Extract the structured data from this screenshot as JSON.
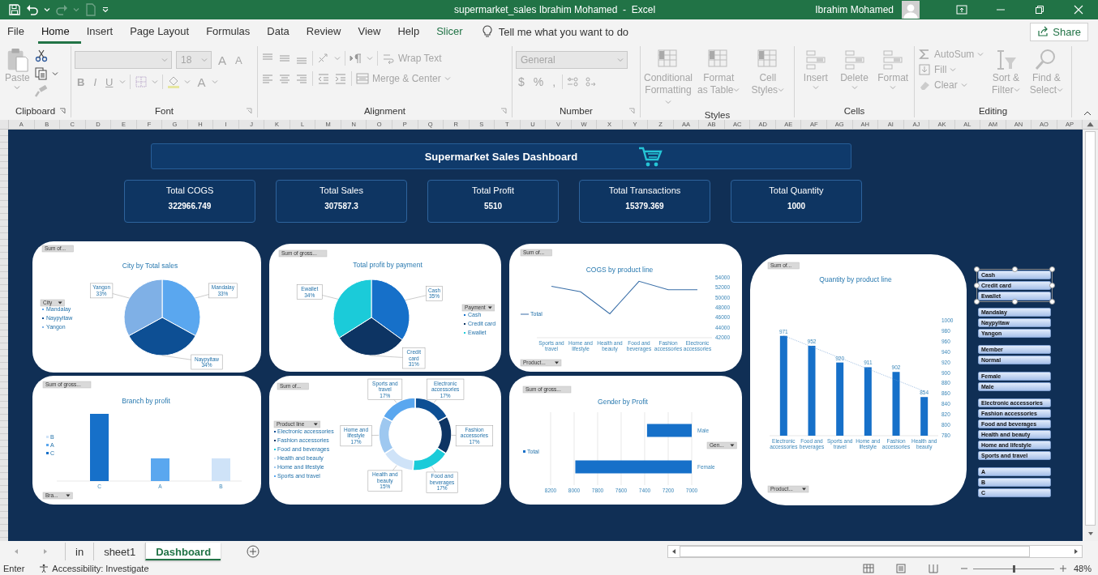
{
  "title_bar": {
    "title": "supermarket_sales Ibrahim Mohamed  -  Excel",
    "user": "Ibrahim Mohamed"
  },
  "menu": [
    {
      "label": "File",
      "selected": false,
      "kind": "tab"
    },
    {
      "label": "Home",
      "selected": true,
      "kind": "tab"
    },
    {
      "label": "Insert",
      "selected": false,
      "kind": "tab"
    },
    {
      "label": "Page Layout",
      "selected": false,
      "kind": "tab"
    },
    {
      "label": "Formulas",
      "selected": false,
      "kind": "tab"
    },
    {
      "label": "Data",
      "selected": false,
      "kind": "tab"
    },
    {
      "label": "Review",
      "selected": false,
      "kind": "tab"
    },
    {
      "label": "View",
      "selected": false,
      "kind": "tab"
    },
    {
      "label": "Help",
      "selected": false,
      "kind": "tab"
    },
    {
      "label": "Slicer",
      "selected": false,
      "kind": "contextual"
    }
  ],
  "tell_me": {
    "placeholder": "Tell me what you want to do"
  },
  "share": {
    "label": "Share"
  },
  "ribbon": {
    "disabled": true,
    "clipboard": {
      "label": "Clipboard",
      "paste": "Paste"
    },
    "font": {
      "label": "Font",
      "size": "18",
      "grow": "A",
      "shrink": "A",
      "bold": "B",
      "italic": "I",
      "underline": "U",
      "font_color": "A"
    },
    "alignment": {
      "label": "Alignment",
      "wrap": "Wrap Text",
      "merge": "Merge & Center"
    },
    "number": {
      "label": "Number",
      "format": "General",
      "symbols": [
        "$",
        "%",
        ","
      ]
    },
    "styles": {
      "label": "Styles",
      "buttons": [
        "Conditional Formatting",
        "Format as Table",
        "Cell Styles"
      ]
    },
    "cells": {
      "label": "Cells",
      "buttons": [
        "Insert",
        "Delete",
        "Format"
      ]
    },
    "editing": {
      "label": "Editing",
      "small": [
        "AutoSum",
        "Fill",
        "Clear"
      ],
      "large": [
        "Sort & Filter",
        "Find & Select"
      ]
    }
  },
  "columns": [
    "A",
    "B",
    "C",
    "D",
    "E",
    "F",
    "G",
    "H",
    "I",
    "J",
    "K",
    "L",
    "M",
    "N",
    "O",
    "P",
    "Q",
    "R",
    "S",
    "T",
    "U",
    "V",
    "W",
    "X",
    "Y",
    "Z",
    "AA",
    "AB",
    "AC",
    "AD",
    "AE",
    "AF",
    "AG",
    "AH",
    "AI",
    "AJ",
    "AK",
    "AL",
    "AM",
    "AN",
    "AO",
    "AP"
  ],
  "dashboard": {
    "title": "Supermarket Sales Dashboard",
    "kpis": [
      {
        "label": "Total COGS",
        "value": "322966.749"
      },
      {
        "label": "Total Sales",
        "value": "307587.3"
      },
      {
        "label": "Total Profit",
        "value": "5510"
      },
      {
        "label": "Total Transactions",
        "value": "15379.369"
      },
      {
        "label": "Total Quantity",
        "value": "1000"
      }
    ],
    "city_pie": {
      "value_field": "Sum of...",
      "legend": {
        "field": "City",
        "items": [
          {
            "label": "Mandalay",
            "color": "#5aa7ef"
          },
          {
            "label": "Naypyitaw",
            "color": "#0d4f94"
          },
          {
            "label": "Yangon",
            "color": "#7fb0e6"
          }
        ]
      },
      "chart_data": {
        "type": "pie",
        "title": "City by Total sales",
        "categories": [
          "Mandalay",
          "Naypyitaw",
          "Yangon"
        ],
        "values": [
          33,
          34,
          33
        ],
        "value_labels": [
          "33%",
          "34%",
          "33%"
        ]
      }
    },
    "payment_pie": {
      "value_field": "Sum of gross...",
      "legend": {
        "field": "Payment",
        "items": [
          {
            "label": "Cash",
            "color": "#1670c9"
          },
          {
            "label": "Credit card",
            "color": "#0d3463"
          },
          {
            "label": "Ewallet",
            "color": "#1bcbd9"
          }
        ]
      },
      "chart_data": {
        "type": "pie",
        "title": "Total profit by payment",
        "categories": [
          "Cash",
          "Credit card",
          "Ewallet"
        ],
        "values": [
          35,
          31,
          34
        ],
        "value_labels": [
          "35%",
          "31%",
          "34%"
        ]
      }
    },
    "cogs_line": {
      "value_field": "Sum of...",
      "axis_field": "Product...",
      "chart_data": {
        "type": "line",
        "title": "COGS by product line",
        "categories": [
          "Sports and travel",
          "Home and lifestyle",
          "Health and beauty",
          "Food and beverages",
          "Fashion accessories",
          "Electronic accessories"
        ],
        "series": [
          {
            "name": "Total",
            "color": "#3a6fa8",
            "values": [
              52300,
              51200,
              46800,
              53300,
              51600,
              51600
            ]
          }
        ],
        "ylim": [
          42000,
          54000
        ],
        "yticks": [
          42000,
          44000,
          46000,
          48000,
          50000,
          52000,
          54000
        ]
      }
    },
    "quantity_bar": {
      "value_field": "Sum of...",
      "axis_field": "Product...",
      "chart_data": {
        "type": "bar",
        "title": "Quantity by product line",
        "categories": [
          "Electronic accessories",
          "Food and beverages",
          "Sports and travel",
          "Home and lifestyle",
          "Fashion accessories",
          "Health and beauty"
        ],
        "series": [
          {
            "color": "#1670c9",
            "values": [
              971,
              952,
              920,
              911,
              902,
              854
            ]
          }
        ],
        "ylim": [
          780,
          1000
        ],
        "yticks": [
          780,
          800,
          820,
          840,
          860,
          880,
          900,
          920,
          940,
          960,
          980,
          1000
        ],
        "data_labels": true
      }
    },
    "branch_bar": {
      "title": "Branch by profit",
      "value_field": "Sum of gross...",
      "axis_field": "Bra...",
      "legend": [
        {
          "label": "B",
          "color": "#cfe3f8"
        },
        {
          "label": "A",
          "color": "#5aa7ef"
        },
        {
          "label": "C",
          "color": "#1670c9"
        }
      ],
      "bars": [
        {
          "label": "C",
          "color": "#1670c9",
          "level": 0.92
        },
        {
          "label": "A",
          "color": "#5aa7ef",
          "level": 0.31
        },
        {
          "label": "B",
          "color": "#cfe3f8",
          "level": 0.31
        }
      ]
    },
    "product_donut": {
      "value_field": "Sum of...",
      "legend": {
        "field": "Product line",
        "items": [
          {
            "label": "Electronic accessories",
            "color": "#0d4f94"
          },
          {
            "label": "Fashion accessories",
            "color": "#0d3463"
          },
          {
            "label": "Food and beverages",
            "color": "#1bcbd9"
          },
          {
            "label": "Health and beauty",
            "color": "#cfe3f8"
          },
          {
            "label": "Home and lifestyle",
            "color": "#9ec8f0"
          },
          {
            "label": "Sports and travel",
            "color": "#5aa7ef"
          }
        ]
      },
      "chart_data": {
        "type": "donut",
        "categories": [
          "Electronic accessories",
          "Fashion accessories",
          "Food and beverages",
          "Health and beauty",
          "Home and lifestyle",
          "Sports and travel"
        ],
        "values": [
          17,
          17,
          17,
          15,
          17,
          17
        ],
        "value_labels": [
          "17%",
          "17%",
          "17%",
          "15%",
          "17%",
          "17%"
        ]
      }
    },
    "gender_bar": {
      "value_field": "Sum of gross...",
      "legend_field": "Gen...",
      "chart_data": {
        "type": "bar",
        "orientation": "horizontal",
        "title": "Gender by Profit",
        "categories": [
          "Male",
          "Female"
        ],
        "series": [
          {
            "name": "Total",
            "color": "#1670c9",
            "values": [
              7380,
              7990
            ]
          }
        ],
        "xlim": [
          8200,
          7000
        ],
        "xticks": [
          8200,
          8000,
          7800,
          7600,
          7400,
          7200,
          7000
        ],
        "grid": true
      }
    },
    "slicers": [
      {
        "selected": true,
        "items": [
          "Cash",
          "Credit card",
          "Ewallet"
        ]
      },
      {
        "selected": false,
        "items": [
          "Mandalay",
          "Naypyitaw",
          "Yangon"
        ]
      },
      {
        "selected": false,
        "items": [
          "Member",
          "Normal"
        ]
      },
      {
        "selected": false,
        "items": [
          "Female",
          "Male"
        ]
      },
      {
        "selected": false,
        "items": [
          "Electronic accessories",
          "Fashion accessories",
          "Food and beverages",
          "Health and beauty",
          "Home and lifestyle",
          "Sports and travel"
        ]
      },
      {
        "selected": false,
        "items": [
          "A",
          "B",
          "C"
        ]
      }
    ]
  },
  "sheet_tabs": [
    {
      "label": "in",
      "selected": false
    },
    {
      "label": "sheet1",
      "selected": false
    },
    {
      "label": "Dashboard",
      "selected": true
    }
  ],
  "status_bar": {
    "mode": "Enter",
    "accessibility": "Accessibility: Investigate",
    "zoom_slider": {
      "level": 0.5
    },
    "zoom": "48%"
  }
}
